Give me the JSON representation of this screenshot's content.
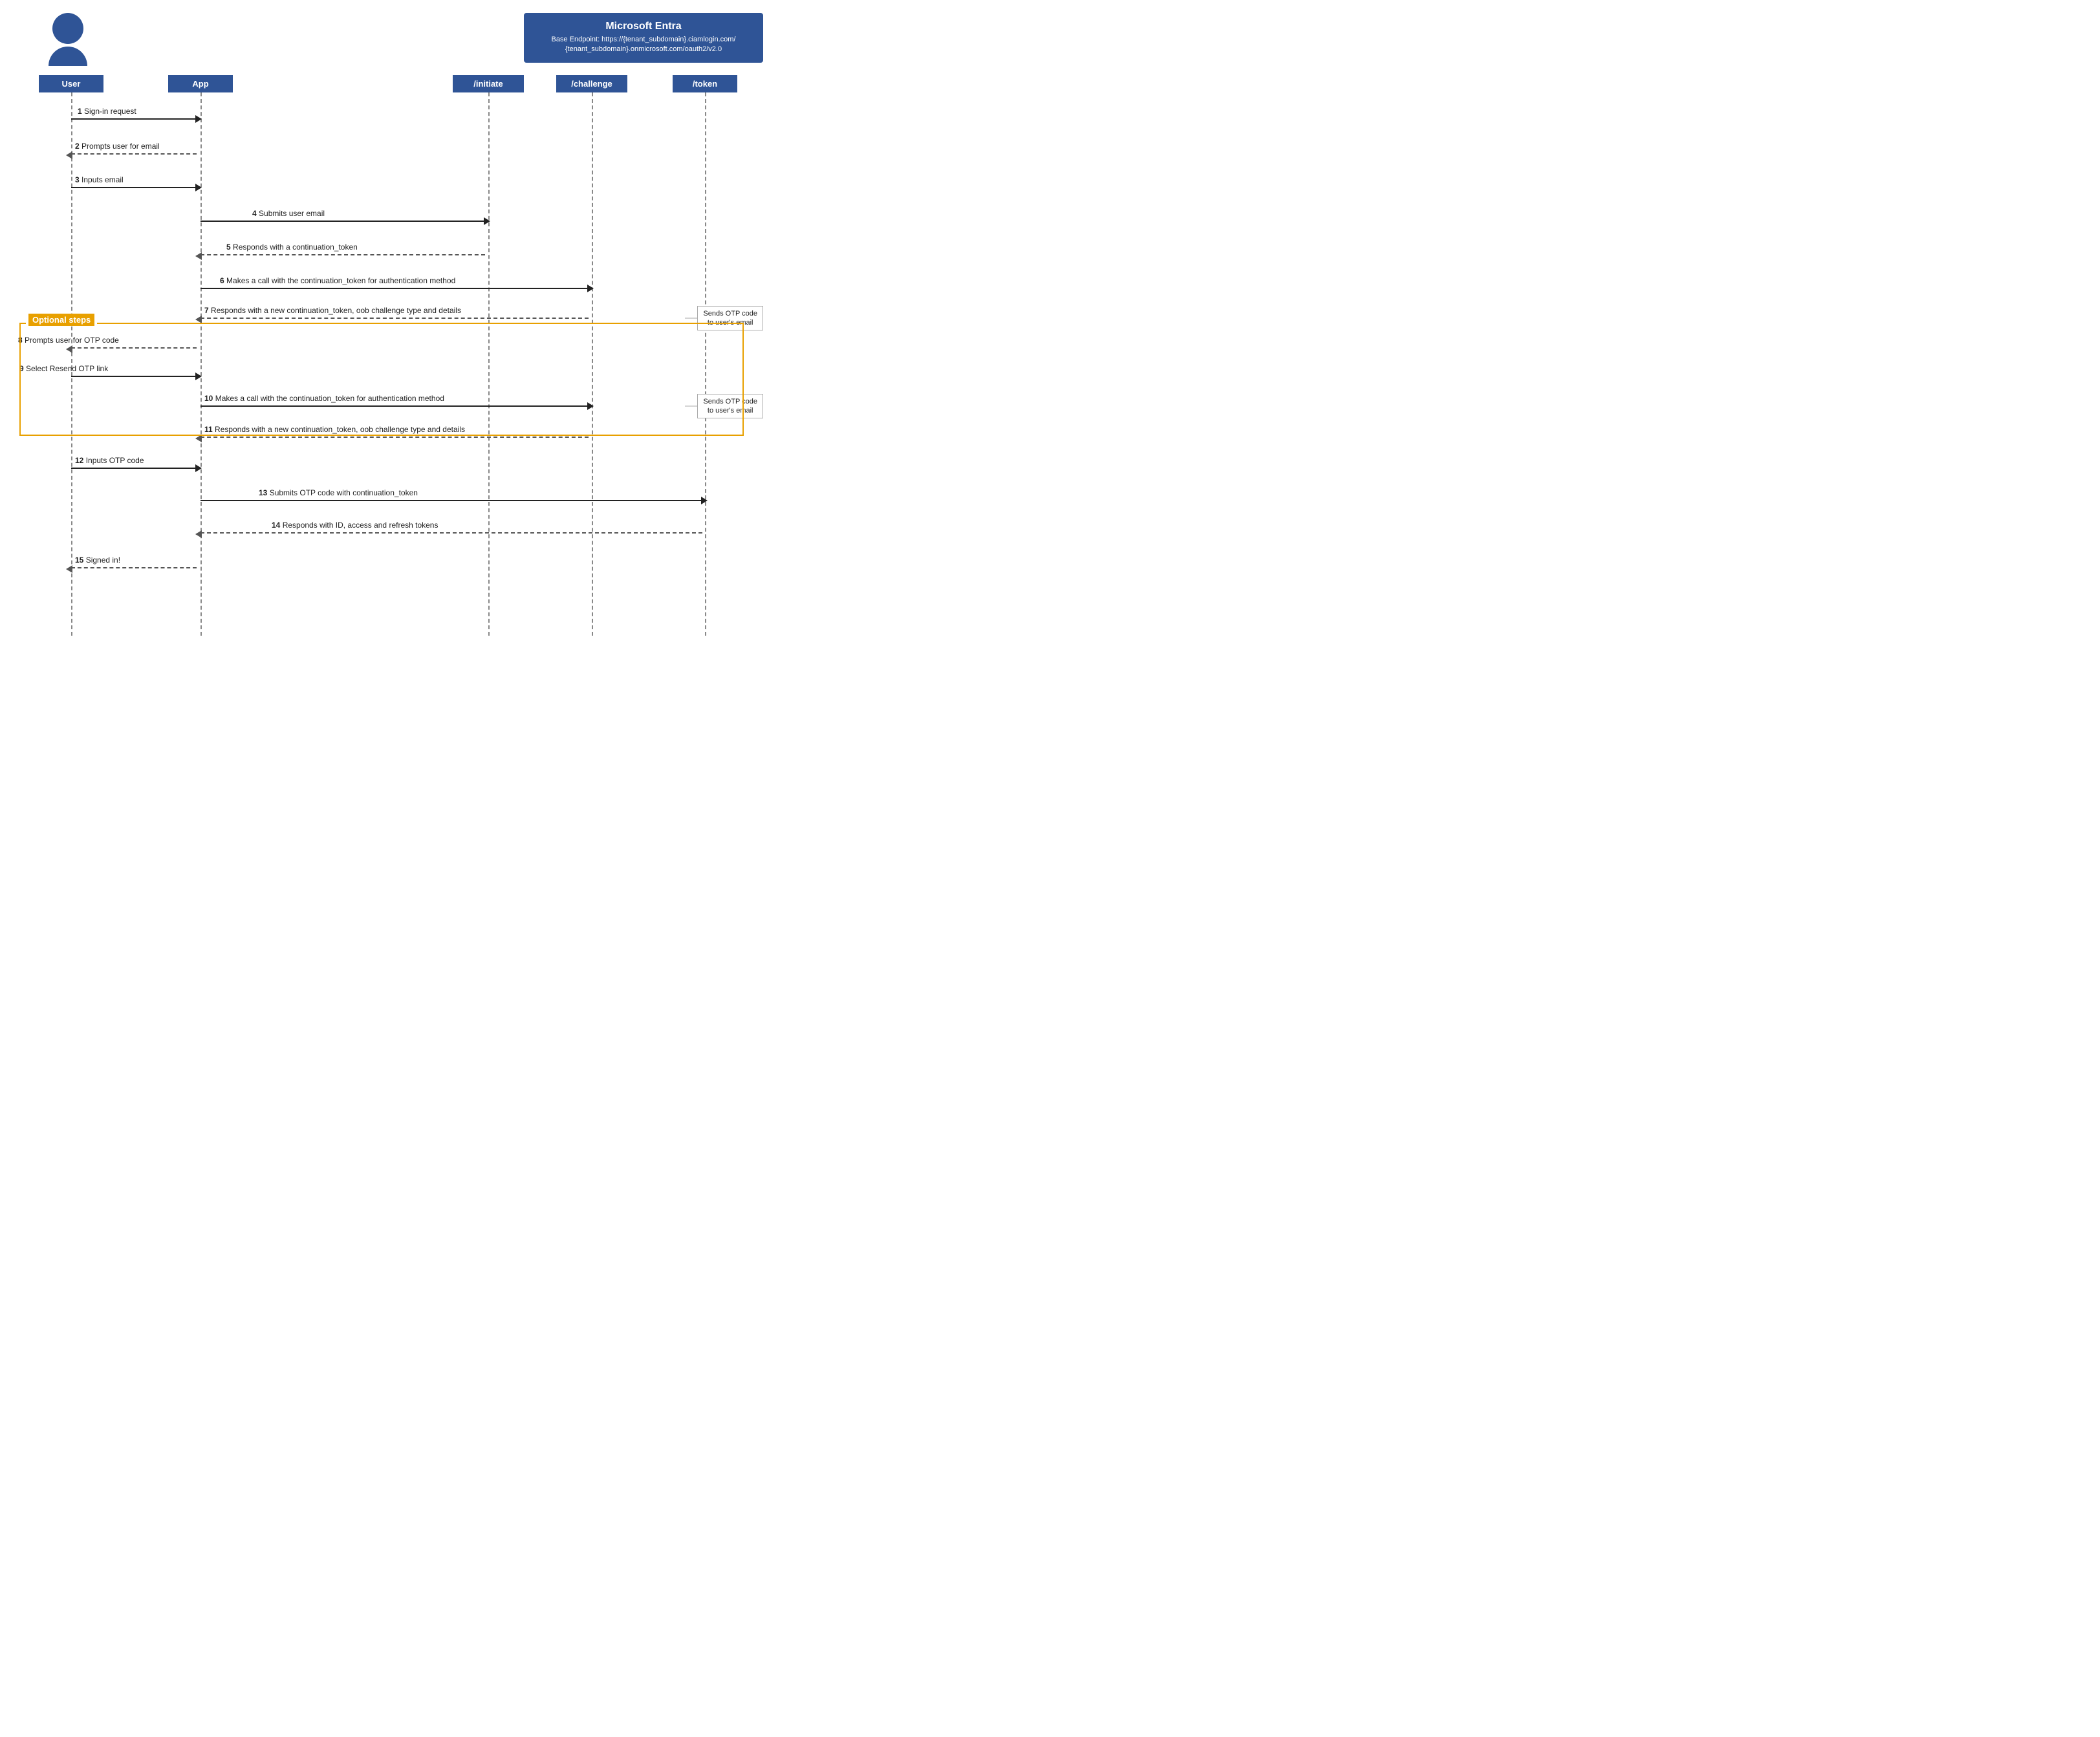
{
  "header": {
    "ms_entra_title": "Microsoft Entra",
    "ms_entra_subtitle": "Base Endpoint: https://{tenant_subdomain}.ciamlogin.com/\n{tenant_subdomain}.onmicrosoft.com/oauth2/v2.0"
  },
  "lifelines": {
    "user": "User",
    "app": "App",
    "initiate": "/initiate",
    "challenge": "/challenge",
    "token": "/token"
  },
  "steps": [
    {
      "num": "1",
      "text": "Sign-in request",
      "from": "user",
      "to": "app",
      "type": "solid",
      "direction": "right"
    },
    {
      "num": "2",
      "text": "Prompts user for email",
      "from": "app",
      "to": "user",
      "type": "dashed",
      "direction": "left"
    },
    {
      "num": "3",
      "text": "Inputs email",
      "from": "user",
      "to": "app",
      "type": "solid",
      "direction": "right"
    },
    {
      "num": "4",
      "text": "Submits user email",
      "from": "app",
      "to": "initiate",
      "type": "solid",
      "direction": "right"
    },
    {
      "num": "5",
      "text": "Responds with a continuation_token",
      "from": "initiate",
      "to": "app",
      "type": "dashed",
      "direction": "left"
    },
    {
      "num": "6",
      "text": "Makes a call with the continuation_token for authentication method",
      "from": "app",
      "to": "challenge",
      "type": "solid",
      "direction": "right"
    },
    {
      "num": "7",
      "text": "Responds with a new continuation_token, oob challenge type and details",
      "from": "challenge",
      "to": "app",
      "type": "dashed",
      "direction": "left"
    },
    {
      "num": "8",
      "text": "Prompts user for OTP code",
      "from": "app",
      "to": "user",
      "type": "dashed",
      "direction": "left"
    },
    {
      "num": "9",
      "text": "Select Resend OTP link",
      "from": "user",
      "to": "app",
      "type": "solid",
      "direction": "right",
      "optional": true
    },
    {
      "num": "10",
      "text": "Makes a call with the continuation_token for authentication method",
      "from": "app",
      "to": "challenge",
      "type": "solid",
      "direction": "right",
      "optional": true
    },
    {
      "num": "11",
      "text": "Responds with a new continuation_token, oob challenge type and details",
      "from": "challenge",
      "to": "app",
      "type": "dashed",
      "direction": "left",
      "optional": true
    },
    {
      "num": "12",
      "text": "Inputs OTP code",
      "from": "user",
      "to": "app",
      "type": "solid",
      "direction": "right"
    },
    {
      "num": "13",
      "text": "Submits OTP code with continuation_token",
      "from": "app",
      "to": "token",
      "type": "solid",
      "direction": "right"
    },
    {
      "num": "14",
      "text": "Responds with  ID, access and refresh tokens",
      "from": "token",
      "to": "app",
      "type": "dashed",
      "direction": "left"
    },
    {
      "num": "15",
      "text": "Signed in!",
      "from": "app",
      "to": "user",
      "type": "dashed",
      "direction": "left"
    }
  ],
  "optional_label": "Optional steps",
  "side_notes": [
    {
      "text": "Sends OTP code\nto user's email",
      "step": 7
    },
    {
      "text": "Sends OTP code\nto user's email",
      "step": 11
    }
  ]
}
